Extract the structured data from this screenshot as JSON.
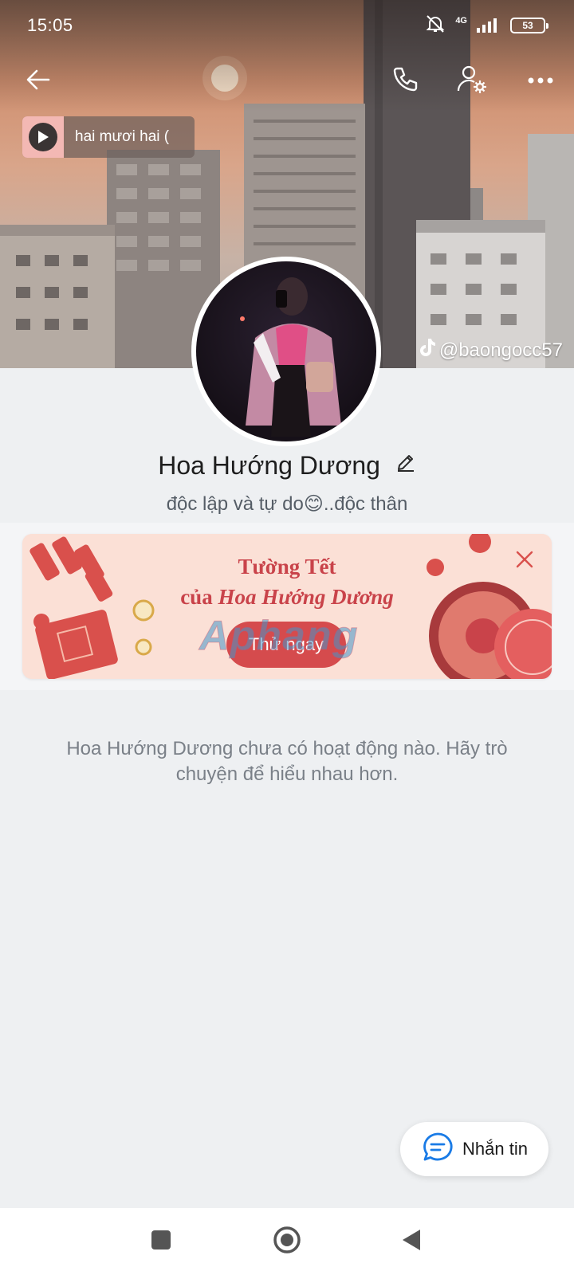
{
  "status_bar": {
    "time": "15:05",
    "network": "4G",
    "battery": "53"
  },
  "cover": {
    "music_title": "hai mươi hai (",
    "tiktok_handle": "@baongocc57"
  },
  "profile": {
    "name": "Hoa Hướng Dương",
    "bio": "độc lập và tự do😊..độc thân"
  },
  "banner": {
    "title_line1": "Tường Tết",
    "title_line2_prefix": "của ",
    "title_line2_name": "Hoa Hướng Dương",
    "cta_label": "Thử ngay",
    "watermark": "Aphang"
  },
  "feed": {
    "empty_message": "Hoa Hướng Dương chưa có hoạt động nào. Hãy trò chuyện để hiểu nhau hơn."
  },
  "actions": {
    "message_label": "Nhắn tin"
  },
  "icons": {
    "back": "arrow-left-icon",
    "call": "phone-icon",
    "settings": "user-settings-icon",
    "more": "more-dots-icon",
    "play": "play-icon",
    "edit": "pencil-icon",
    "close": "close-icon",
    "chat": "chat-bubble-icon"
  },
  "colors": {
    "accent_red": "#d54b4d",
    "banner_bg": "#fbe0d6",
    "chat_blue": "#1a7be6",
    "page_bg": "#eef0f2"
  }
}
